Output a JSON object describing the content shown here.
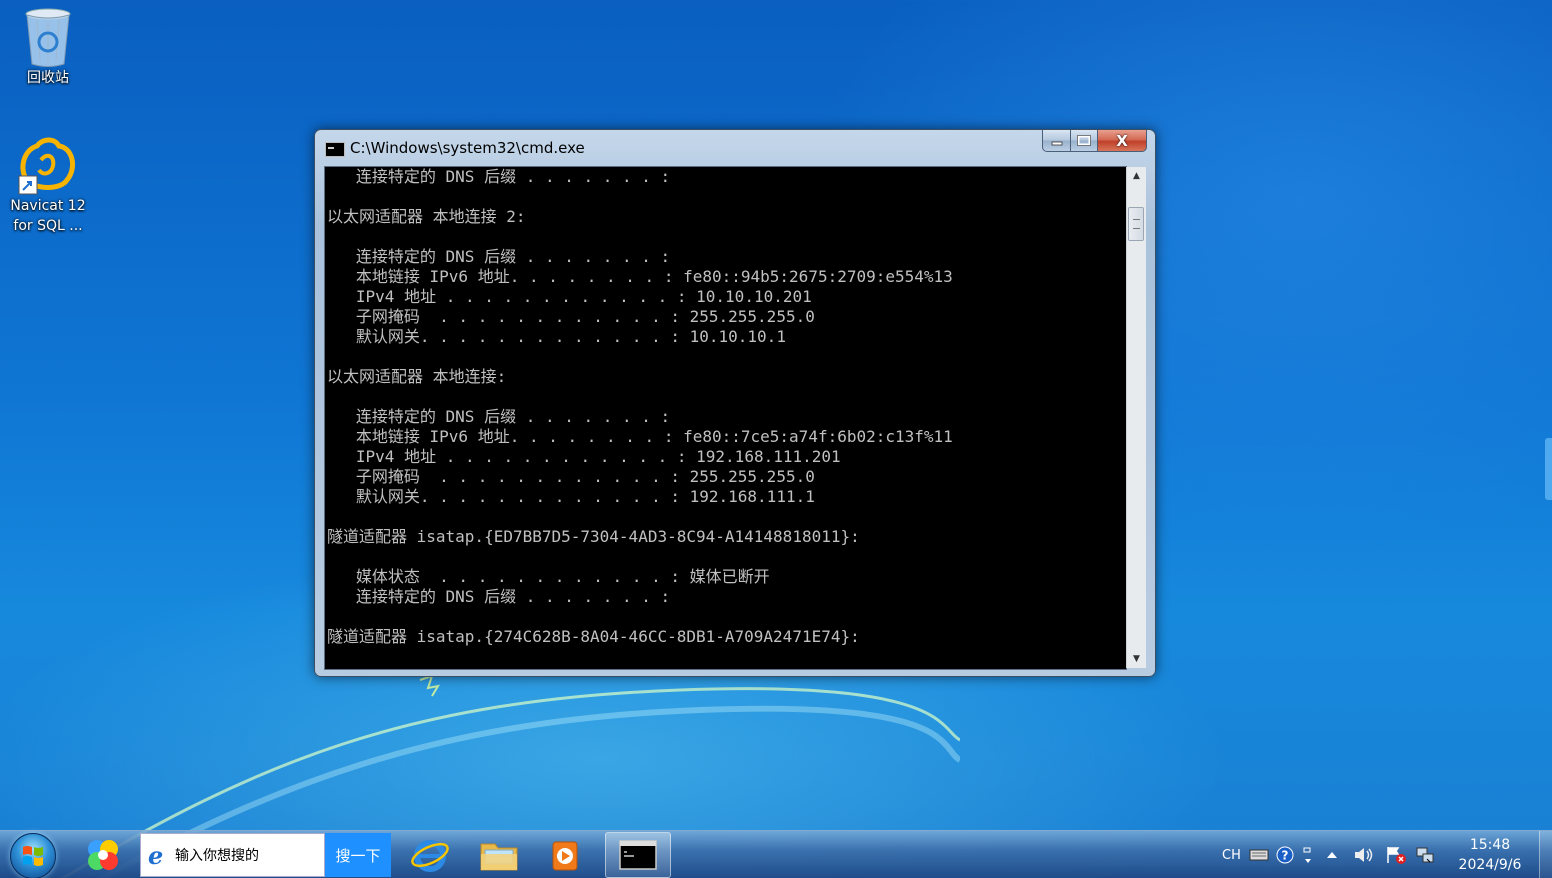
{
  "desktop": {
    "icons": [
      {
        "label": "回收站",
        "icon": "recycle-bin-icon"
      },
      {
        "label_line1": "Navicat 12",
        "label_line2": "for SQL ...",
        "icon": "navicat-icon"
      }
    ]
  },
  "window": {
    "title": "C:\\Windows\\system32\\cmd.exe",
    "close_label": "X",
    "console_text": "   连接特定的 DNS 后缀 . . . . . . . :\n\n以太网适配器 本地连接 2:\n\n   连接特定的 DNS 后缀 . . . . . . . :\n   本地链接 IPv6 地址. . . . . . . . : fe80::94b5:2675:2709:e554%13\n   IPv4 地址 . . . . . . . . . . . . : 10.10.10.201\n   子网掩码  . . . . . . . . . . . . : 255.255.255.0\n   默认网关. . . . . . . . . . . . . : 10.10.10.1\n\n以太网适配器 本地连接:\n\n   连接特定的 DNS 后缀 . . . . . . . :\n   本地链接 IPv6 地址. . . . . . . . : fe80::7ce5:a74f:6b02:c13f%11\n   IPv4 地址 . . . . . . . . . . . . : 192.168.111.201\n   子网掩码  . . . . . . . . . . . . : 255.255.255.0\n   默认网关. . . . . . . . . . . . . : 192.168.111.1\n\n隧道适配器 isatap.{ED7BB7D5-7304-4AD3-8C94-A14148818011}:\n\n   媒体状态  . . . . . . . . . . . . : 媒体已断开\n   连接特定的 DNS 后缀 . . . . . . . :\n\n隧道适配器 isatap.{274C628B-8A04-46CC-8DB1-A709A2471E74}:"
  },
  "taskbar": {
    "search_placeholder": "输入你想搜的",
    "search_button": "搜一下",
    "tray": {
      "lang": "CH",
      "time": "15:48",
      "date": "2024/9/6"
    }
  },
  "colors": {
    "console_bg": "#000000",
    "console_fg": "#c0c0c0",
    "search_button": "#1e90ff",
    "close_button": "#c0402a"
  }
}
